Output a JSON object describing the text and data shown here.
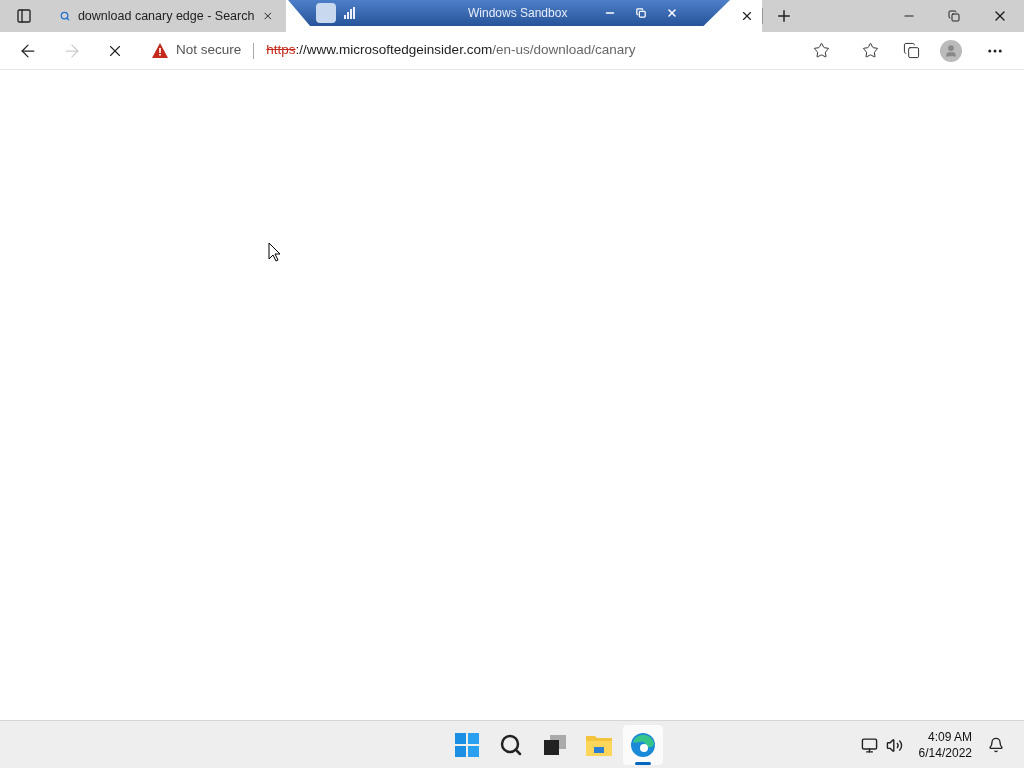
{
  "tabs": [
    {
      "title": "download canary edge - Search",
      "selected": false
    },
    {
      "selected": true
    }
  ],
  "sandbox_bar": {
    "title": "Windows Sandbox"
  },
  "address_bar": {
    "security": "Not secure",
    "scheme": "https",
    "host": "://www.microsoftedgeinsider.com",
    "path": "/en-us/download/canary"
  },
  "taskbar": {
    "apps": [
      {
        "kind": "start",
        "active": false
      },
      {
        "kind": "search",
        "active": false
      },
      {
        "kind": "taskview",
        "active": false
      },
      {
        "kind": "explorer",
        "active": false
      },
      {
        "kind": "edge",
        "active": true
      }
    ],
    "time": "4:09 AM",
    "date": "6/14/2022"
  }
}
